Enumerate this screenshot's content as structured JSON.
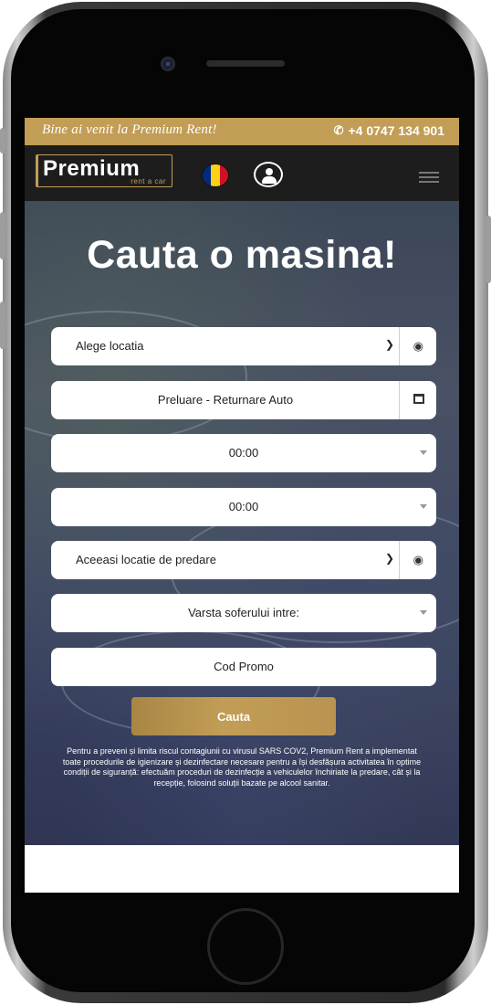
{
  "topbar": {
    "welcome": "Bine ai venit la Premium Rent!",
    "phone_icon": "phone-icon",
    "phone": "+4 0747 134 901"
  },
  "navbar": {
    "logo_main": "Premium",
    "logo_sub": "rent a car",
    "flag_colors": [
      "#002B7F",
      "#FCD116",
      "#CE1126"
    ],
    "user_icon": "user-icon",
    "menu_icon": "hamburger-menu-icon"
  },
  "hero": {
    "title": "Cauta o masina!"
  },
  "form": {
    "location": {
      "value": "Alege locatia",
      "icon": "eye-icon"
    },
    "dates": {
      "value": "Preluare - Returnare Auto",
      "icon": "calendar-icon"
    },
    "time_pickup": {
      "value": "00:00"
    },
    "time_return": {
      "value": "00:00"
    },
    "return_location": {
      "value": "Aceeasi locatie de predare",
      "icon": "eye-icon"
    },
    "driver_age": {
      "value": "Varsta soferului intre:"
    },
    "promo": {
      "placeholder": "Cod Promo"
    },
    "search_label": "Cauta"
  },
  "notice": "Pentru a preveni și limita riscul contagiunii cu virusul SARS COV2, Premium Rent a implementat toate procedurile de igienizare și dezinfectare necesare pentru a își desfășura activitatea în optime condiții de siguranță: efectuăm proceduri de dezinfecție a vehiculelor închiriate la predare, cât și la recepție, folosind soluții bazate pe alcool sanitar.",
  "colors": {
    "accent": "#c29d56",
    "navbar": "#1d1d1d"
  }
}
